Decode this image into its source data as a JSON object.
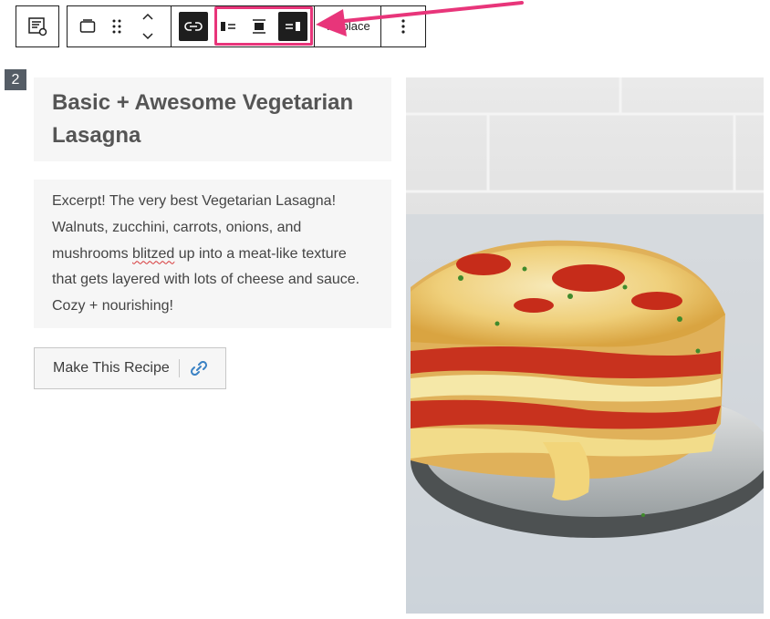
{
  "toolbar": {
    "block_type_icon": "table-of-contents-icon",
    "parent_icon": "card-icon",
    "drag_icon": "drag-handle-icon",
    "move_up_icon": "chevron-up-icon",
    "move_down_icon": "chevron-down-icon",
    "link_icon": "link-icon",
    "align_left_icon": "media-left-icon",
    "align_center_icon": "media-center-icon",
    "align_right_icon": "media-right-icon",
    "replace_label": "Replace",
    "more_icon": "more-vertical-icon",
    "highlight_color": "#e8357a"
  },
  "block_number": "2",
  "recipe": {
    "title": "Basic + Awesome Vegetarian Lasagna",
    "excerpt_before": "Excerpt! The very best Vegetarian Lasagna! Walnuts, zucchini, carrots, onions, and mushrooms ",
    "excerpt_misspelled": "blitzed",
    "excerpt_after": " up into a meat-like texture that gets layered with lots of cheese and sauce. Cozy + nourishing!",
    "button_label": "Make This Recipe",
    "button_link_icon": "link-icon",
    "image_subject": "lasagna-on-plate"
  }
}
